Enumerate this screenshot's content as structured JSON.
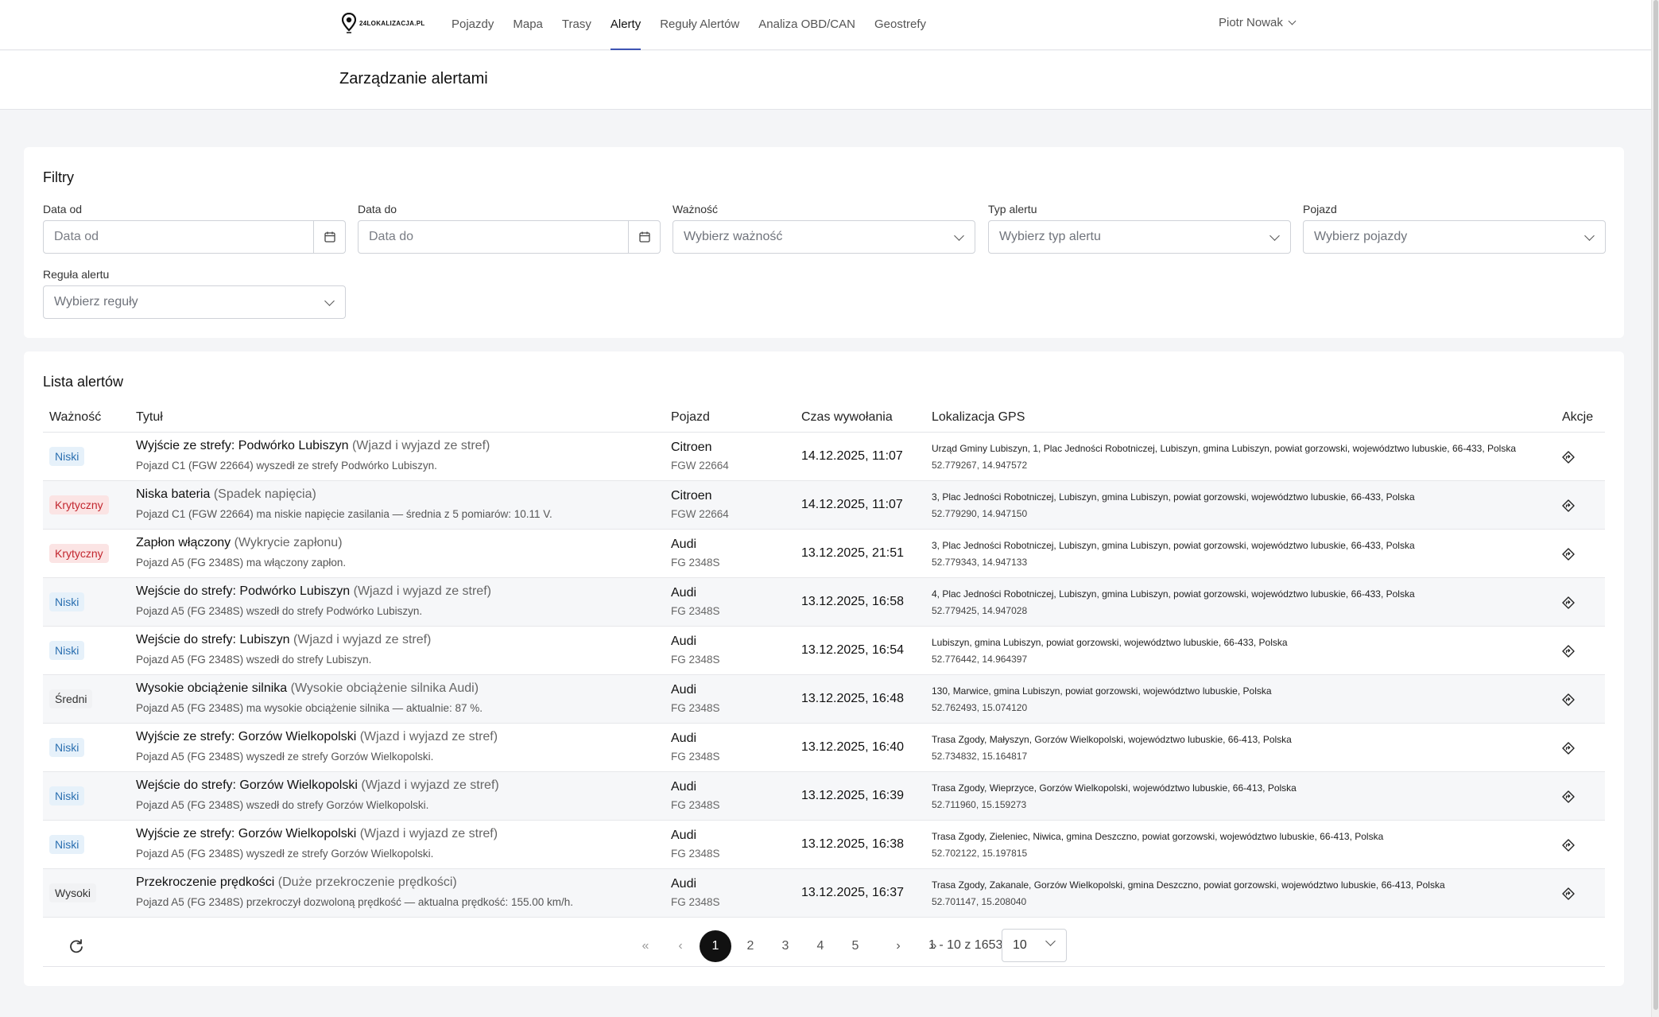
{
  "app": {
    "logo_text": "24LOKALIZACJA.PL",
    "nav": [
      "Pojazdy",
      "Mapa",
      "Trasy",
      "Alerty",
      "Reguły Alertów",
      "Analiza OBD/CAN",
      "Geostrefy"
    ],
    "active_nav": "Alerty",
    "user": "Piotr Nowak"
  },
  "page": {
    "title": "Zarządzanie alertami"
  },
  "filters": {
    "title": "Filtry",
    "date_from": {
      "label": "Data od",
      "placeholder": "Data od",
      "value": ""
    },
    "date_to": {
      "label": "Data do",
      "placeholder": "Data do",
      "value": ""
    },
    "severity": {
      "label": "Ważność",
      "placeholder": "Wybierz ważność"
    },
    "alert_type": {
      "label": "Typ alertu",
      "placeholder": "Wybierz typ alertu"
    },
    "vehicle": {
      "label": "Pojazd",
      "placeholder": "Wybierz pojazdy"
    },
    "rule": {
      "label": "Reguła alertu",
      "placeholder": "Wybierz reguły"
    }
  },
  "alerts": {
    "title": "Lista alertów",
    "columns": {
      "severity": "Ważność",
      "title": "Tytuł",
      "vehicle": "Pojazd",
      "time": "Czas wywołania",
      "location": "Lokalizacja GPS",
      "actions": "Akcje"
    },
    "rows": [
      {
        "severity": "Niski",
        "title": "Wyjście ze strefy: Podwórko Lubiszyn",
        "type": "(Wjazd i wyjazd ze stref)",
        "desc": "Pojazd C1 (FGW 22664) wyszedł ze strefy Podwórko Lubiszyn.",
        "vehicle": "Citroen",
        "plate": "FGW 22664",
        "time": "14.12.2025, 11:07",
        "address": "Urząd Gminy Lubiszyn, 1, Plac Jedności Robotniczej, Lubiszyn, gmina Lubiszyn, powiat gorzowski, województwo lubuskie, 66-433, Polska",
        "coords": "52.779267, 14.947572"
      },
      {
        "severity": "Krytyczny",
        "title": "Niska bateria",
        "type": "(Spadek napięcia)",
        "desc": "Pojazd C1 (FGW 22664) ma niskie napięcie zasilania — średnia z 5 pomiarów: 10.11 V.",
        "vehicle": "Citroen",
        "plate": "FGW 22664",
        "time": "14.12.2025, 11:07",
        "address": "3, Plac Jedności Robotniczej, Lubiszyn, gmina Lubiszyn, powiat gorzowski, województwo lubuskie, 66-433, Polska",
        "coords": "52.779290, 14.947150"
      },
      {
        "severity": "Krytyczny",
        "title": "Zapłon włączony",
        "type": "(Wykrycie zapłonu)",
        "desc": "Pojazd A5 (FG 2348S) ma włączony zapłon.",
        "vehicle": "Audi",
        "plate": "FG 2348S",
        "time": "13.12.2025, 21:51",
        "address": "3, Plac Jedności Robotniczej, Lubiszyn, gmina Lubiszyn, powiat gorzowski, województwo lubuskie, 66-433, Polska",
        "coords": "52.779343, 14.947133"
      },
      {
        "severity": "Niski",
        "title": "Wejście do strefy: Podwórko Lubiszyn",
        "type": "(Wjazd i wyjazd ze stref)",
        "desc": "Pojazd A5 (FG 2348S) wszedł do strefy Podwórko Lubiszyn.",
        "vehicle": "Audi",
        "plate": "FG 2348S",
        "time": "13.12.2025, 16:58",
        "address": "4, Plac Jedności Robotniczej, Lubiszyn, gmina Lubiszyn, powiat gorzowski, województwo lubuskie, 66-433, Polska",
        "coords": "52.779425, 14.947028"
      },
      {
        "severity": "Niski",
        "title": "Wejście do strefy: Lubiszyn",
        "type": "(Wjazd i wyjazd ze stref)",
        "desc": "Pojazd A5 (FG 2348S) wszedł do strefy Lubiszyn.",
        "vehicle": "Audi",
        "plate": "FG 2348S",
        "time": "13.12.2025, 16:54",
        "address": "Lubiszyn, gmina Lubiszyn, powiat gorzowski, województwo lubuskie, 66-433, Polska",
        "coords": "52.776442, 14.964397"
      },
      {
        "severity": "Średni",
        "title": "Wysokie obciążenie silnika",
        "type": "(Wysokie obciążenie silnika Audi)",
        "desc": "Pojazd A5 (FG 2348S) ma wysokie obciążenie silnika — aktualnie: 87 %.",
        "vehicle": "Audi",
        "plate": "FG 2348S",
        "time": "13.12.2025, 16:48",
        "address": "130, Marwice, gmina Lubiszyn, powiat gorzowski, województwo lubuskie, Polska",
        "coords": "52.762493, 15.074120"
      },
      {
        "severity": "Niski",
        "title": "Wyjście ze strefy: Gorzów Wielkopolski",
        "type": "(Wjazd i wyjazd ze stref)",
        "desc": "Pojazd A5 (FG 2348S) wyszedł ze strefy Gorzów Wielkopolski.",
        "vehicle": "Audi",
        "plate": "FG 2348S",
        "time": "13.12.2025, 16:40",
        "address": "Trasa Zgody, Małyszyn, Gorzów Wielkopolski, województwo lubuskie, 66-413, Polska",
        "coords": "52.734832, 15.164817"
      },
      {
        "severity": "Niski",
        "title": "Wejście do strefy: Gorzów Wielkopolski",
        "type": "(Wjazd i wyjazd ze stref)",
        "desc": "Pojazd A5 (FG 2348S) wszedł do strefy Gorzów Wielkopolski.",
        "vehicle": "Audi",
        "plate": "FG 2348S",
        "time": "13.12.2025, 16:39",
        "address": "Trasa Zgody, Wieprzyce, Gorzów Wielkopolski, województwo lubuskie, 66-413, Polska",
        "coords": "52.711960, 15.159273"
      },
      {
        "severity": "Niski",
        "title": "Wyjście ze strefy: Gorzów Wielkopolski",
        "type": "(Wjazd i wyjazd ze stref)",
        "desc": "Pojazd A5 (FG 2348S) wyszedł ze strefy Gorzów Wielkopolski.",
        "vehicle": "Audi",
        "plate": "FG 2348S",
        "time": "13.12.2025, 16:38",
        "address": "Trasa Zgody, Zieleniec, Niwica, gmina Deszczno, powiat gorzowski, województwo lubuskie, 66-413, Polska",
        "coords": "52.702122, 15.197815"
      },
      {
        "severity": "Wysoki",
        "title": "Przekroczenie prędkości",
        "type": "(Duże przekroczenie prędkości)",
        "desc": "Pojazd A5 (FG 2348S) przekroczył dozwoloną prędkość — aktualna prędkość: 155.00 km/h.",
        "vehicle": "Audi",
        "plate": "FG 2348S",
        "time": "13.12.2025, 16:37",
        "address": "Trasa Zgody, Zakanale, Gorzów Wielkopolski, gmina Deszczno, powiat gorzowski, województwo lubuskie, 66-413, Polska",
        "coords": "52.701147, 15.208040"
      }
    ]
  },
  "pagination": {
    "first": "«",
    "prev": "‹",
    "pages": [
      "1",
      "2",
      "3",
      "4",
      "5"
    ],
    "current": "1",
    "next": "›",
    "last": "»",
    "info": "1 - 10 z 1653",
    "page_size": "10"
  },
  "icons": {
    "refresh": "refresh-icon",
    "calendar": "calendar-icon",
    "action": "navigate-diamond-icon",
    "chevron": "chevron-down-icon"
  }
}
